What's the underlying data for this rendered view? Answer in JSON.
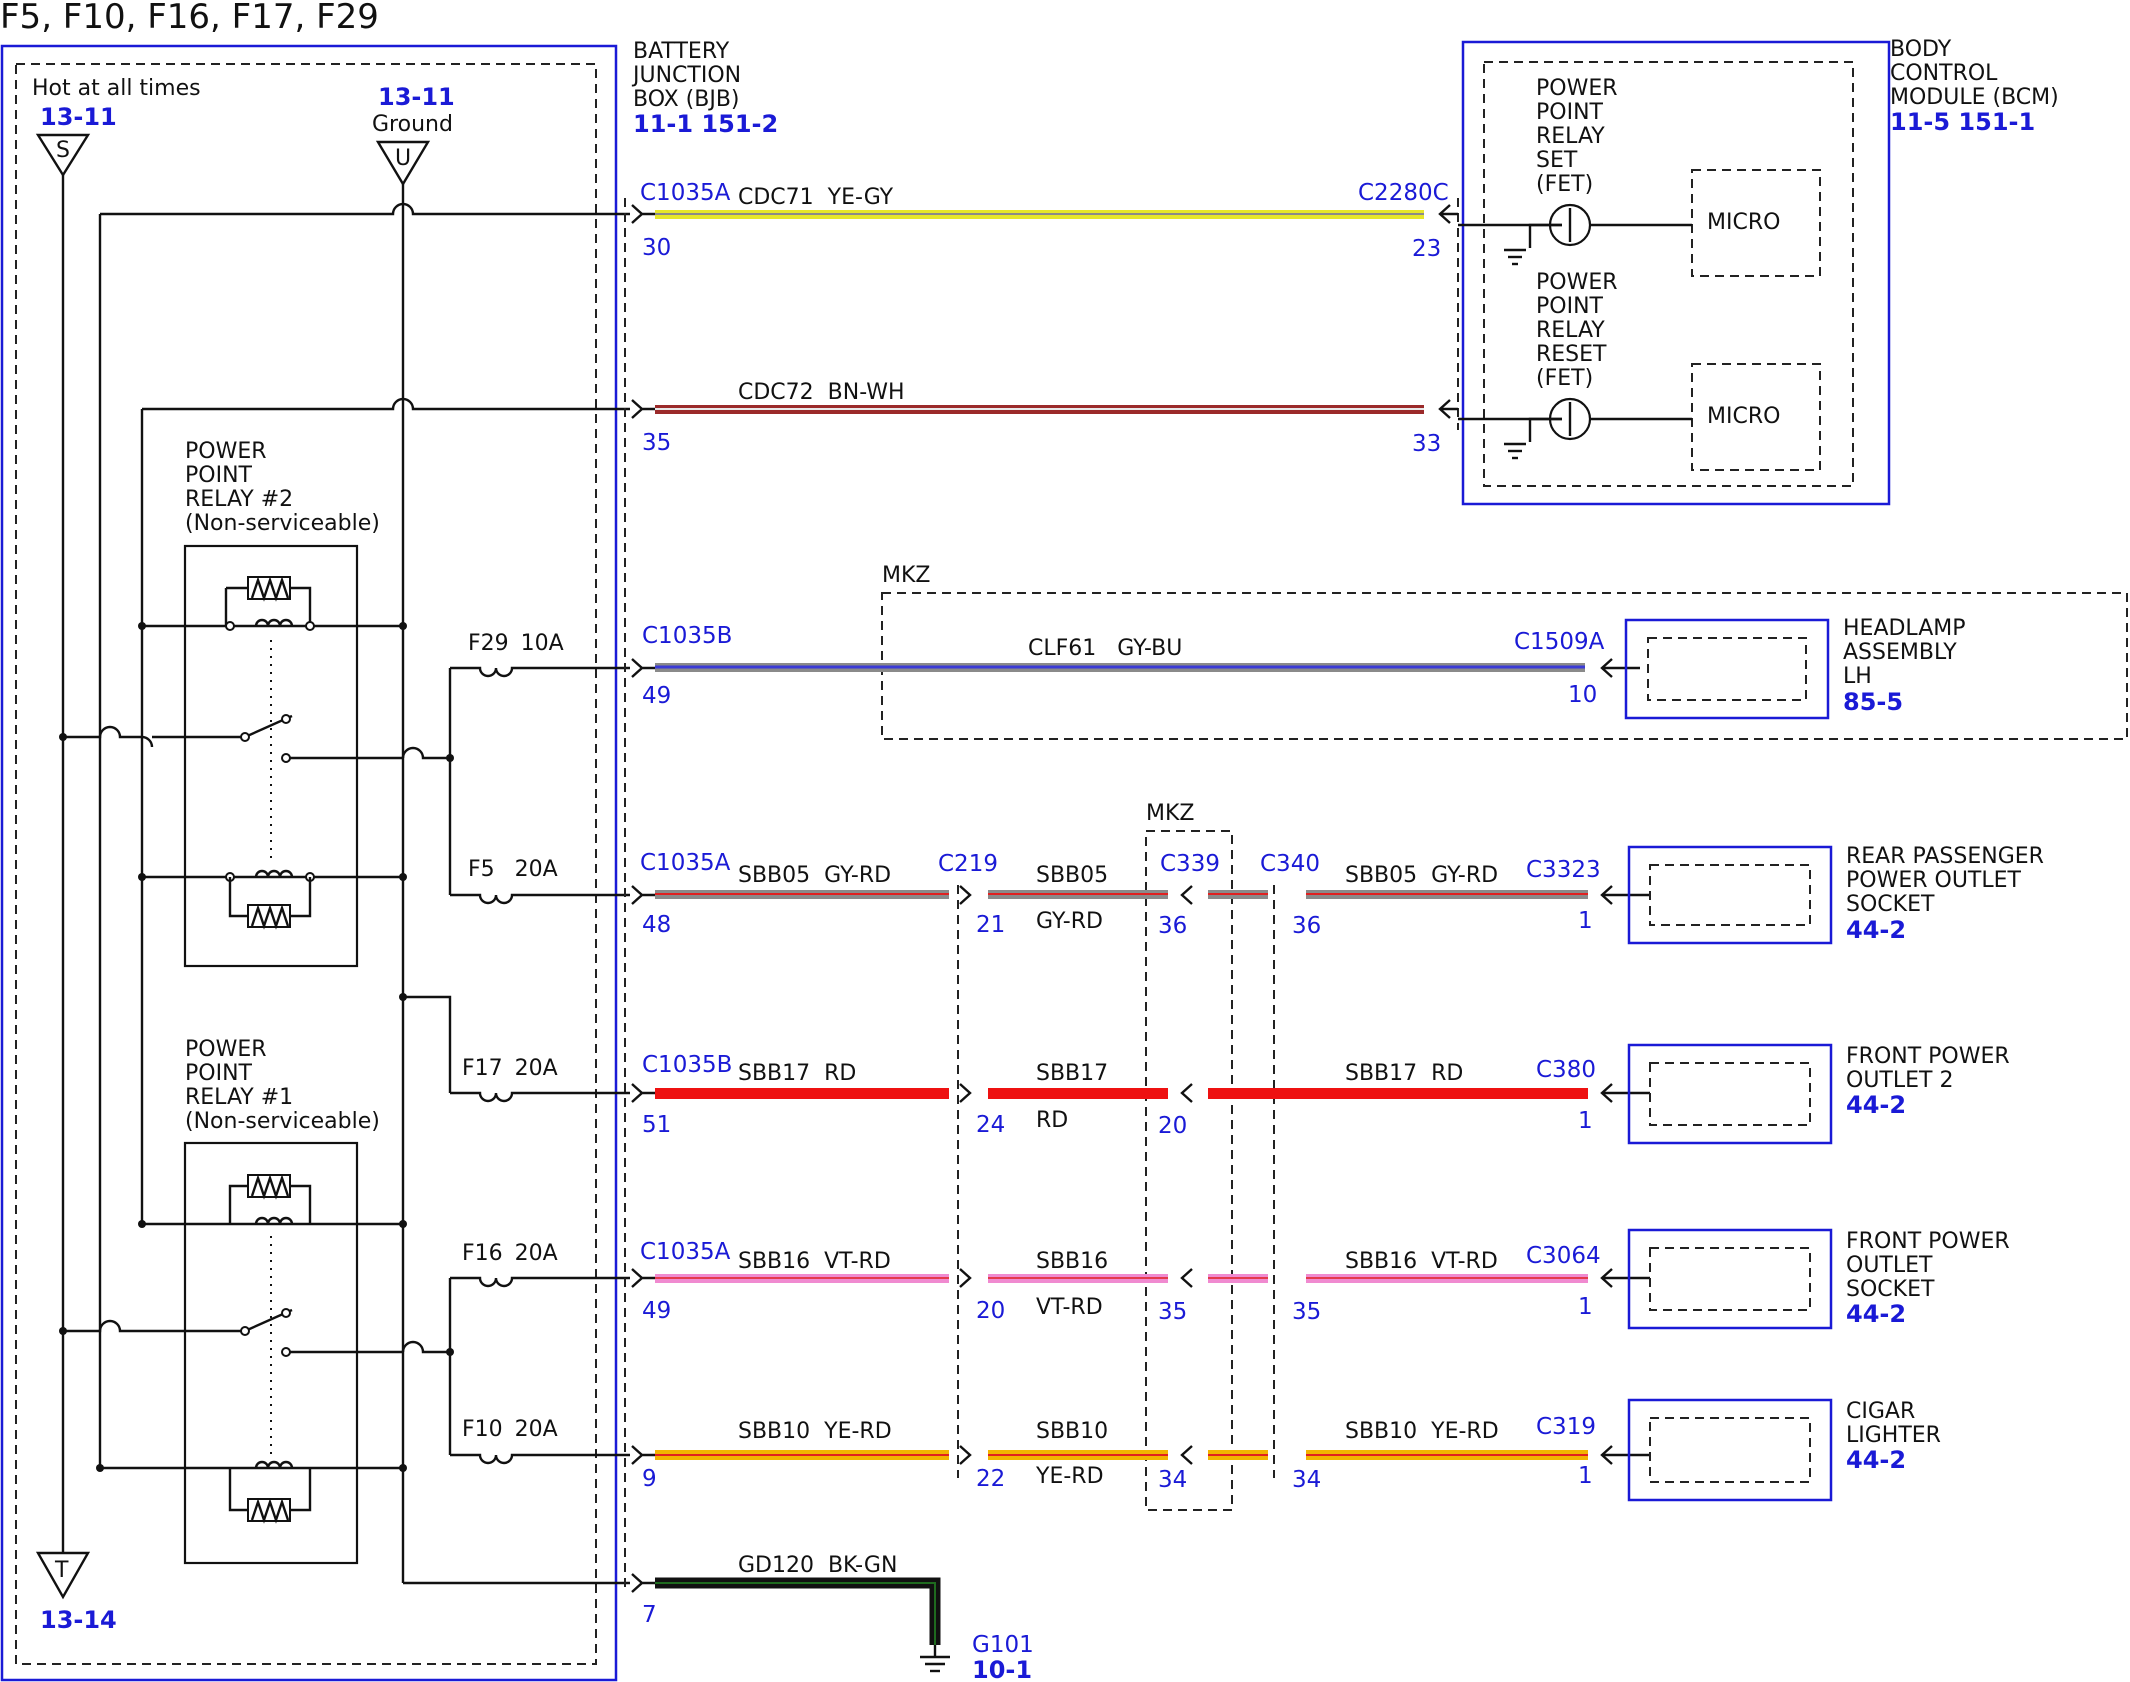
{
  "title": "F5, F10, F16, F17, F29",
  "bjb": {
    "hot_label": "Hot at all times",
    "ref_s": "13-11",
    "ref_u": "13-11",
    "ground_label": "Ground",
    "ref_t": "13-14",
    "tag_s": "S",
    "tag_u": "U",
    "tag_t": "T",
    "name_lines": [
      "BATTERY",
      "JUNCTION",
      "BOX (BJB)"
    ],
    "refs": "11-1   151-2",
    "relay2_lines": [
      "POWER",
      "POINT",
      "RELAY #2",
      "(Non-serviceable)"
    ],
    "relay1_lines": [
      "POWER",
      "POINT",
      "RELAY #1",
      "(Non-serviceable)"
    ],
    "fuses": [
      {
        "name": "F29",
        "rating": "10A"
      },
      {
        "name": "F5",
        "rating": "20A"
      },
      {
        "name": "F17",
        "rating": "20A"
      },
      {
        "name": "F16",
        "rating": "20A"
      },
      {
        "name": "F10",
        "rating": "20A"
      }
    ]
  },
  "bcm": {
    "name_lines": [
      "BODY",
      "CONTROL",
      "MODULE (BCM)"
    ],
    "refs": "11-5   151-1",
    "set_lines": [
      "POWER",
      "POINT",
      "RELAY",
      "SET",
      "(FET)"
    ],
    "reset_lines": [
      "POWER",
      "POINT",
      "RELAY",
      "RESET",
      "(FET)"
    ],
    "micro": "MICRO"
  },
  "circuits": [
    {
      "conn": "C1035A",
      "circuit": "CDC71  YE-GY",
      "pin": "30",
      "far_conn": "C2280C",
      "far_pin": "23",
      "colors": [
        "#e6e62a",
        "#8a8a8a"
      ]
    },
    {
      "conn": "",
      "circuit": "CDC72  BN-WH",
      "pin": "35",
      "far_conn": "",
      "far_pin": "33",
      "colors": [
        "#9b2a2a",
        "#e8e8e8"
      ]
    },
    {
      "conn": "C1035B",
      "circuit": "CLF61   GY-BU",
      "pin": "49",
      "far_conn": "C1509A",
      "far_pin": "10",
      "colors": [
        "#8a8a8a",
        "#3b3bd6"
      ]
    },
    {
      "conn": "C1035A",
      "circuit": "SBB05  GY-RD",
      "pin": "48",
      "c219_pin": "21",
      "mid": "SBB05",
      "mid_color": "GY-RD",
      "c339_pin": "36",
      "c340_pin": "36",
      "right": "SBB05  GY-RD",
      "far_conn": "C3323",
      "far_pin": "1",
      "colors": [
        "#8a8a8a",
        "#e02020"
      ]
    },
    {
      "conn": "C1035B",
      "circuit": "SBB17  RD",
      "pin": "51",
      "c219_pin": "24",
      "mid": "SBB17",
      "mid_color": "RD",
      "c339_pin": "20",
      "c340_pin": "",
      "right": "SBB17  RD",
      "far_conn": "C380",
      "far_pin": "1",
      "colors": [
        "#ee1111",
        "#ee1111"
      ]
    },
    {
      "conn": "C1035A",
      "circuit": "SBB16  VT-RD",
      "pin": "49",
      "c219_pin": "20",
      "mid": "SBB16",
      "mid_color": "VT-RD",
      "c339_pin": "35",
      "c340_pin": "35",
      "right": "SBB16  VT-RD",
      "far_conn": "C3064",
      "far_pin": "1",
      "colors": [
        "#f08ad0",
        "#e02020"
      ]
    },
    {
      "conn": "",
      "circuit": "SBB10  YE-RD",
      "pin": "9",
      "c219_pin": "22",
      "mid": "SBB10",
      "mid_color": "YE-RD",
      "c339_pin": "34",
      "c340_pin": "34",
      "right": "SBB10  YE-RD",
      "far_conn": "C319",
      "far_pin": "1",
      "colors": [
        "#f2b400",
        "#e02020"
      ]
    },
    {
      "conn": "",
      "circuit": "GD120  BK-GN",
      "pin": "7",
      "colors": [
        "#111111",
        "#1f6b1f"
      ]
    }
  ],
  "inline": {
    "c219": "C219",
    "c339": "C339",
    "c340": "C340",
    "mkz": "MKZ"
  },
  "components": [
    {
      "lines": [
        "HEADLAMP",
        "ASSEMBLY",
        "LH"
      ],
      "ref": "85-5"
    },
    {
      "lines": [
        "REAR PASSENGER",
        "POWER OUTLET",
        "SOCKET"
      ],
      "ref": "44-2"
    },
    {
      "lines": [
        "FRONT POWER",
        "OUTLET 2"
      ],
      "ref": "44-2"
    },
    {
      "lines": [
        "FRONT POWER",
        "OUTLET",
        "SOCKET"
      ],
      "ref": "44-2"
    },
    {
      "lines": [
        "CIGAR",
        "LIGHTER"
      ],
      "ref": "44-2"
    }
  ],
  "ground": {
    "name": "G101",
    "ref": "10-1"
  }
}
